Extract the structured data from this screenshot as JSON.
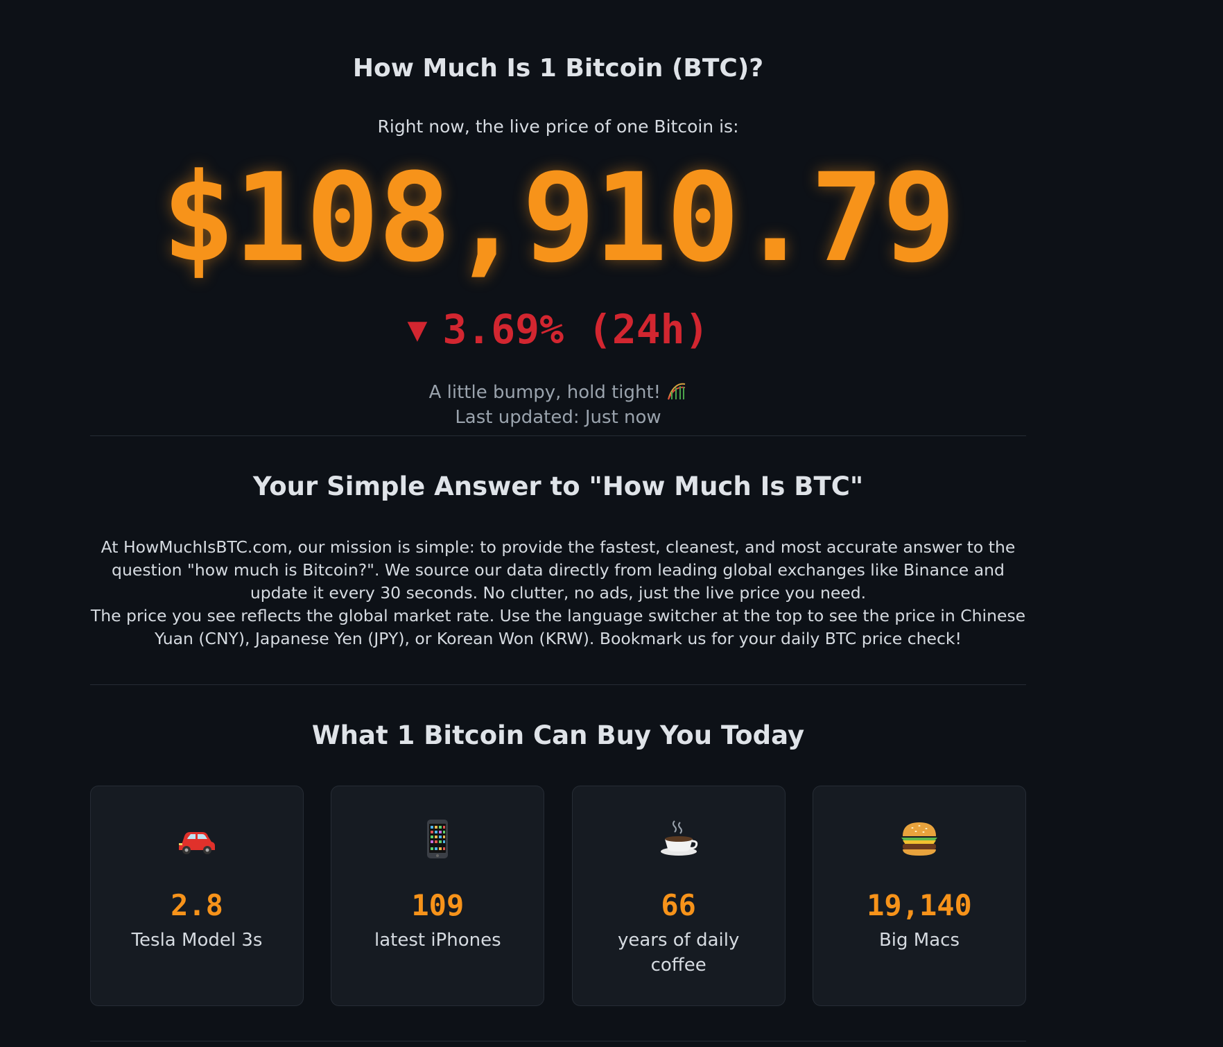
{
  "hero": {
    "title": "How Much Is 1 Bitcoin (BTC)?",
    "subtitle": "Right now, the live price of one Bitcoin is:",
    "price": "$108,910.79",
    "change_arrow": "▼",
    "change_text": "3.69% (24h)",
    "mood_text": "A little bumpy, hold tight!",
    "mood_icon": "roller-coaster-icon",
    "last_updated": "Last updated: Just now"
  },
  "about": {
    "title": "Your Simple Answer to \"How Much Is BTC\"",
    "paragraph1": "At HowMuchIsBTC.com, our mission is simple: to provide the fastest, cleanest, and most accurate answer to the question \"how much is Bitcoin?\". We source our data directly from leading global exchanges like Binance and update it every 30 seconds. No clutter, no ads, just the live price you need.",
    "paragraph2": "The price you see reflects the global market rate. Use the language switcher at the top to see the price in Chinese Yuan (CNY), Japanese Yen (JPY), or Korean Won (KRW). Bookmark us for your daily BTC price check!"
  },
  "buy": {
    "title": "What 1 Bitcoin Can Buy You Today",
    "items": [
      {
        "icon": "car-icon",
        "value": "2.8",
        "label": "Tesla Model 3s"
      },
      {
        "icon": "phone-icon",
        "value": "109",
        "label": "latest iPhones"
      },
      {
        "icon": "coffee-icon",
        "value": "66",
        "label": "years of daily coffee"
      },
      {
        "icon": "burger-icon",
        "value": "19,140",
        "label": "Big Macs"
      }
    ]
  },
  "colors": {
    "background": "#0d1117",
    "accent": "#f7931a",
    "negative": "#d22630",
    "card": "#161b22"
  }
}
